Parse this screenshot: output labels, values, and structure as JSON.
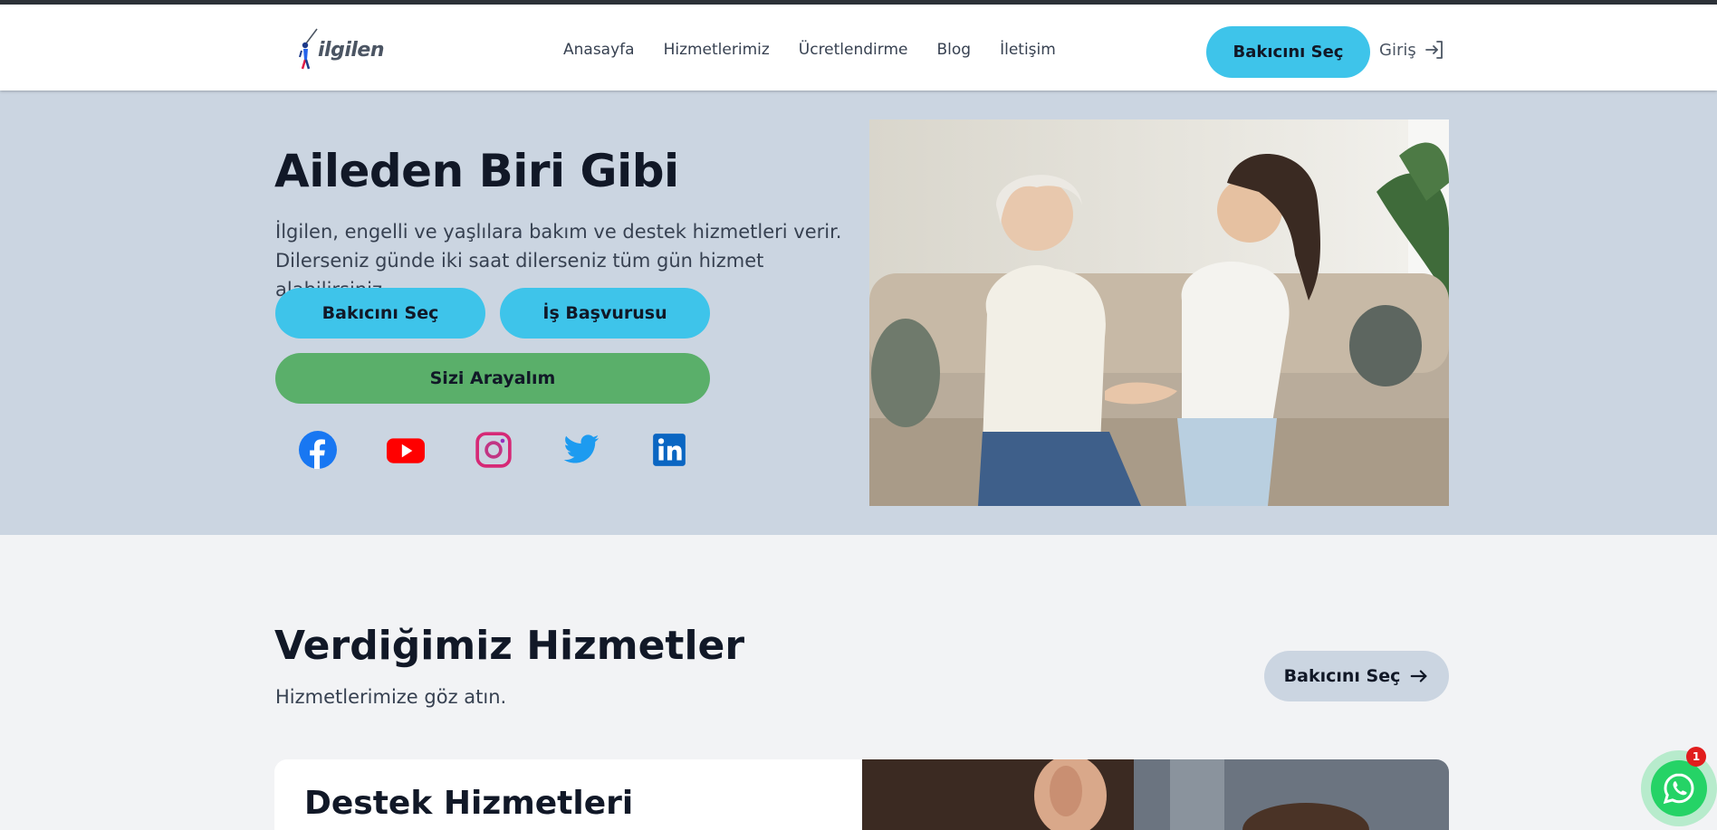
{
  "brand": {
    "logo_text": "ilgilen"
  },
  "nav": {
    "links": [
      "Anasayfa",
      "Hizmetlerimiz",
      "Ücretlendirme",
      "Blog",
      "İletişim"
    ],
    "cta_label": "Bakıcını Seç",
    "login_label": "Giriş"
  },
  "hero": {
    "title": "Aileden Biri Gibi",
    "description_line1": "İlgilen, engelli ve yaşlılara bakım ve destek hizmetleri verir.",
    "description_line2": "Dilerseniz günde iki saat dilerseniz tüm gün hizmet alabilirsiniz.",
    "btn_select": "Bakıcını Seç",
    "btn_apply": "İş Başvurusu",
    "btn_call": "Sizi Arayalım",
    "socials": [
      "facebook-icon",
      "youtube-icon",
      "instagram-icon",
      "twitter-icon",
      "linkedin-icon"
    ]
  },
  "services": {
    "title": "Verdiğimiz Hizmetler",
    "subtitle": "Hizmetlerimize göz atın.",
    "btn_label": "Bakıcını Seç",
    "card_title": "Destek Hizmetleri"
  },
  "whatsapp": {
    "badge_count": "1"
  },
  "colors": {
    "accent": "#3ec4ea",
    "green": "#5aaf6a",
    "hero_bg": "#cbd5e1",
    "page_bg": "#f2f3f5"
  }
}
